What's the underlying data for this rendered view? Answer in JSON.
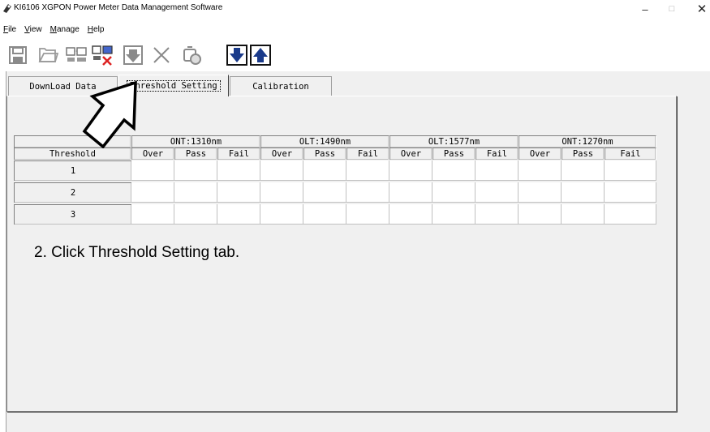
{
  "window": {
    "title": "KI6106 XGPON Power Meter Data Management Software",
    "controls": {
      "minimize": "–",
      "maximize": "□",
      "close": "✕"
    }
  },
  "menu": [
    {
      "acc": "F",
      "rest": "ile"
    },
    {
      "acc": "V",
      "rest": "iew"
    },
    {
      "acc": "M",
      "rest": "anage"
    },
    {
      "acc": "H",
      "rest": "elp"
    }
  ],
  "toolbar": {
    "icons": [
      "save-icon",
      "open-icon",
      "device-icon",
      "device-disconnect-icon",
      "download-icon",
      "delete-icon",
      "clear-icon",
      "download-arrow-icon",
      "upload-arrow-icon"
    ]
  },
  "tabs": {
    "download": "DownLoad Data",
    "threshold": "Threshold Setting",
    "calibration": "Calibration"
  },
  "table": {
    "groups": [
      "ONT:1310nm",
      "OLT:1490nm",
      "OLT:1577nm",
      "ONT:1270nm"
    ],
    "row_header": "Threshold",
    "sub_columns": [
      "Over",
      "Pass",
      "Fail"
    ],
    "rows": [
      "1",
      "2",
      "3"
    ]
  },
  "instruction": "2. Click Threshold Setting tab."
}
